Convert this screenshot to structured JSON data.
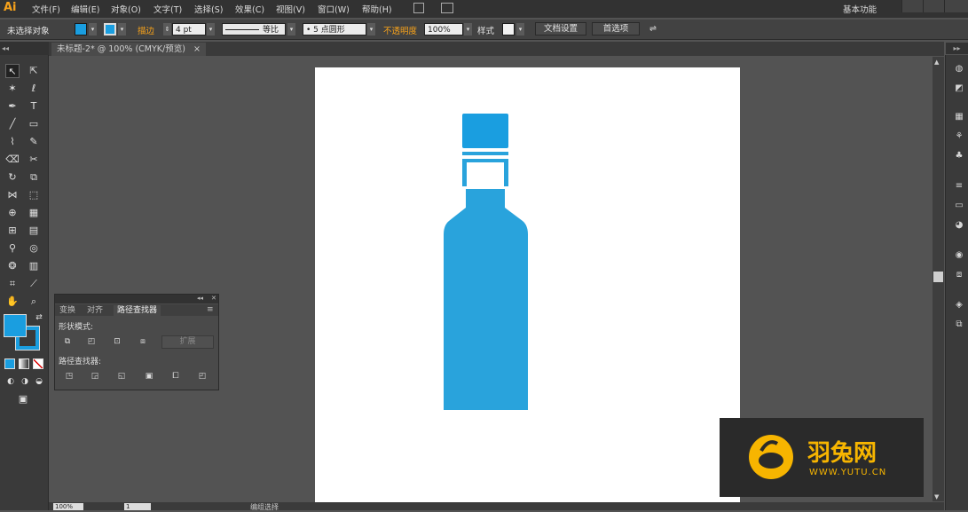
{
  "app": {
    "logo": "Ai",
    "workspace": "基本功能"
  },
  "menu": [
    "文件(F)",
    "编辑(E)",
    "对象(O)",
    "文字(T)",
    "选择(S)",
    "效果(C)",
    "视图(V)",
    "窗口(W)",
    "帮助(H)"
  ],
  "control_bar": {
    "selection_label": "未选择对象",
    "stroke_label": "描边",
    "stroke_weight": "4 pt",
    "stroke_profile": "等比",
    "brush": "5 点圆形",
    "opacity_label": "不透明度",
    "opacity_value": "100%",
    "style_label": "样式",
    "doc_setup_button": "文档设置",
    "preferences_button": "首选项"
  },
  "document_tab": {
    "title": "未标题-2* @ 100% (CMYK/预览)",
    "close": "×"
  },
  "colors": {
    "fill": "#1a9ee0",
    "bottle": "#29a3dc",
    "cap": "#1a9ee0",
    "accent": "#f7a21b"
  },
  "pathfinder_panel": {
    "tabs": [
      "变换",
      "对齐",
      "路径查找器"
    ],
    "shape_modes_label": "形状模式:",
    "expand_button": "扩展",
    "pathfinders_label": "路径查找器:"
  },
  "status_bar": {
    "zoom": "100%",
    "page": "1",
    "mode": "编组选择"
  },
  "watermark": {
    "brand": "羽兔网",
    "url": "WWW.YUTU.CN"
  }
}
